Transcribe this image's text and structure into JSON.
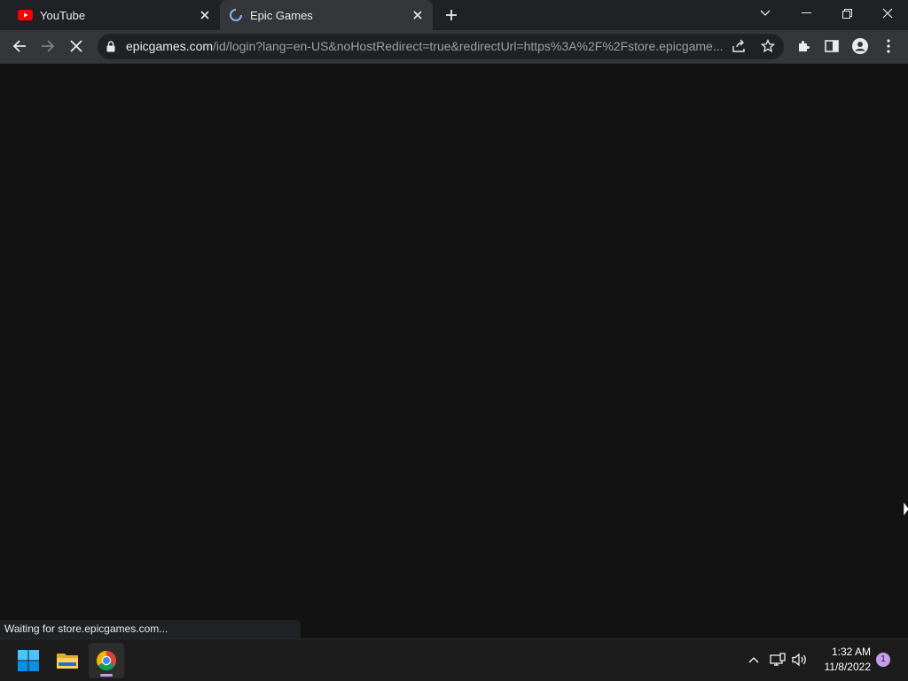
{
  "browser": {
    "tabs": [
      {
        "title": "YouTube",
        "active": false,
        "icon": "youtube-icon"
      },
      {
        "title": "Epic Games",
        "active": true,
        "icon": "loading-spinner-icon"
      }
    ],
    "address": {
      "host": "epicgames.com",
      "path": "/id/login?lang=en-US&noHostRedirect=true&redirectUrl=https%3A%2F%2Fstore.epicgame..."
    },
    "status_text": "Waiting for store.epicgames.com..."
  },
  "taskbar": {
    "apps": [
      "windows-start-icon",
      "file-explorer-icon",
      "chrome-icon"
    ],
    "time": "1:32 AM",
    "date": "11/8/2022",
    "notification_count": "1"
  },
  "colors": {
    "accent": "#c69dee",
    "content_bg": "#121212",
    "toolbar_bg": "#35363a",
    "tabstrip_bg": "#202124"
  }
}
